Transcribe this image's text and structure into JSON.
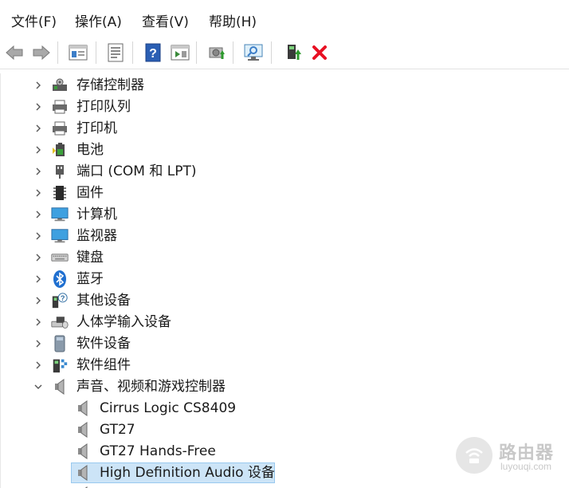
{
  "menu": [
    {
      "label": "文件(F)"
    },
    {
      "label": "操作(A)"
    },
    {
      "label": "查看(V)"
    },
    {
      "label": "帮助(H)"
    }
  ],
  "toolbar": {
    "icons": [
      "back-arrow-icon",
      "forward-arrow-icon",
      "show-hide-console-tree-icon",
      "properties-icon",
      "help-icon",
      "action-pane-icon",
      "update-driver-icon",
      "scan-hardware-icon",
      "enable-device-icon",
      "uninstall-device-icon"
    ]
  },
  "tree": {
    "categories": [
      {
        "label": "存储控制器",
        "icon": "storage-controller-icon"
      },
      {
        "label": "打印队列",
        "icon": "printer-icon"
      },
      {
        "label": "打印机",
        "icon": "printer-icon"
      },
      {
        "label": "电池",
        "icon": "battery-icon"
      },
      {
        "label": "端口 (COM 和 LPT)",
        "icon": "port-icon"
      },
      {
        "label": "固件",
        "icon": "firmware-icon"
      },
      {
        "label": "计算机",
        "icon": "computer-icon"
      },
      {
        "label": "监视器",
        "icon": "monitor-icon"
      },
      {
        "label": "键盘",
        "icon": "keyboard-icon"
      },
      {
        "label": "蓝牙",
        "icon": "bluetooth-icon"
      },
      {
        "label": "其他设备",
        "icon": "other-devices-icon"
      },
      {
        "label": "人体学输入设备",
        "icon": "hid-icon"
      },
      {
        "label": "软件设备",
        "icon": "software-device-icon"
      },
      {
        "label": "软件组件",
        "icon": "software-component-icon"
      },
      {
        "label": "声音、视频和游戏控制器",
        "icon": "speaker-icon",
        "expanded": true
      }
    ],
    "audio_devices": [
      {
        "label": "Cirrus Logic CS8409"
      },
      {
        "label": "GT27"
      },
      {
        "label": "GT27 Hands-Free"
      },
      {
        "label": "High Definition Audio 设备",
        "selected": true
      }
    ]
  },
  "watermark": {
    "title": "路由器",
    "subtitle": "luyouqi.com"
  },
  "colors": {
    "selection": "#cce4f7",
    "selection_border": "#99c9ef",
    "uninstall_red": "#e81123",
    "help_blue": "#2b5fb4"
  }
}
